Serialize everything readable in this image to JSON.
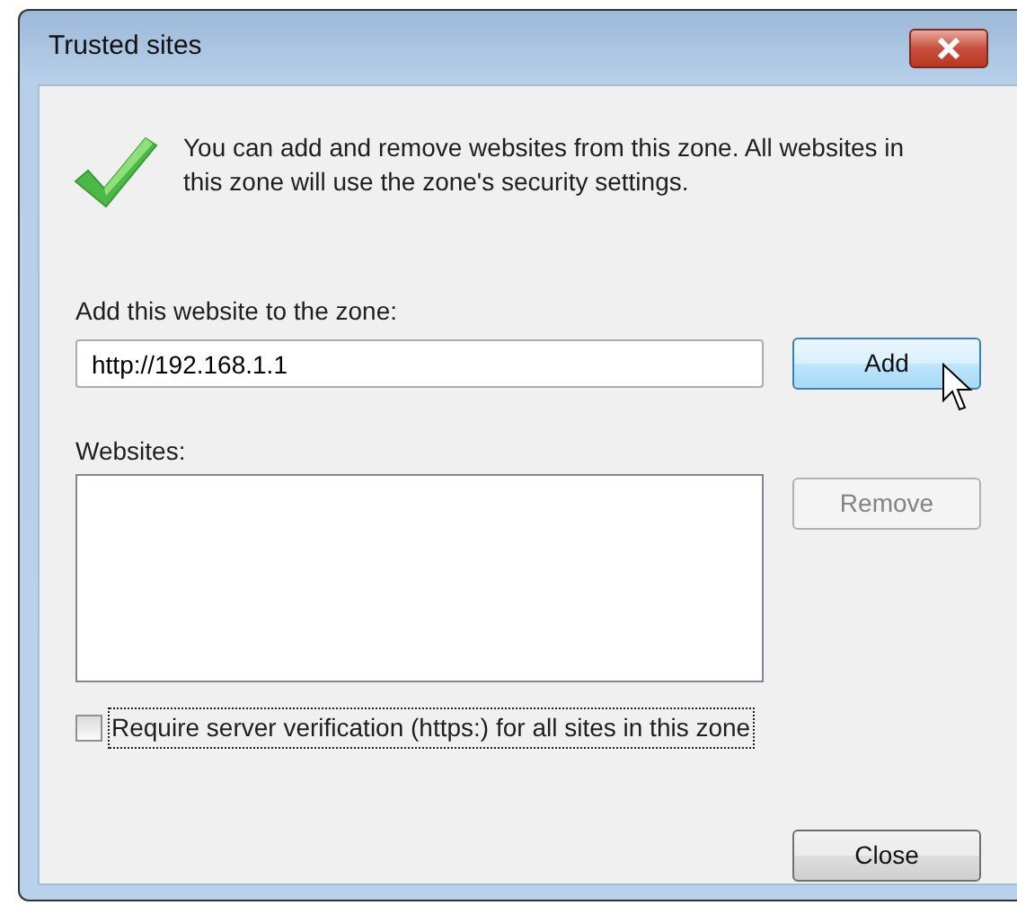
{
  "window": {
    "title": "Trusted sites"
  },
  "message": "You can add and remove websites from this zone. All websites in\nthis zone will use the zone's security settings.",
  "add_field": {
    "label": "Add this website to the zone:",
    "value": "http://192.168.1.1"
  },
  "add_button": {
    "label": "Add",
    "hovered": true,
    "disabled": false
  },
  "websites": {
    "label": "Websites:"
  },
  "remove_button": {
    "label": "Remove",
    "disabled": true
  },
  "https_checkbox": {
    "label": "Require server verification (https:) for all sites in this zone",
    "checked": false,
    "focused": true
  },
  "close_button": {
    "label": "Close",
    "disabled": false
  }
}
